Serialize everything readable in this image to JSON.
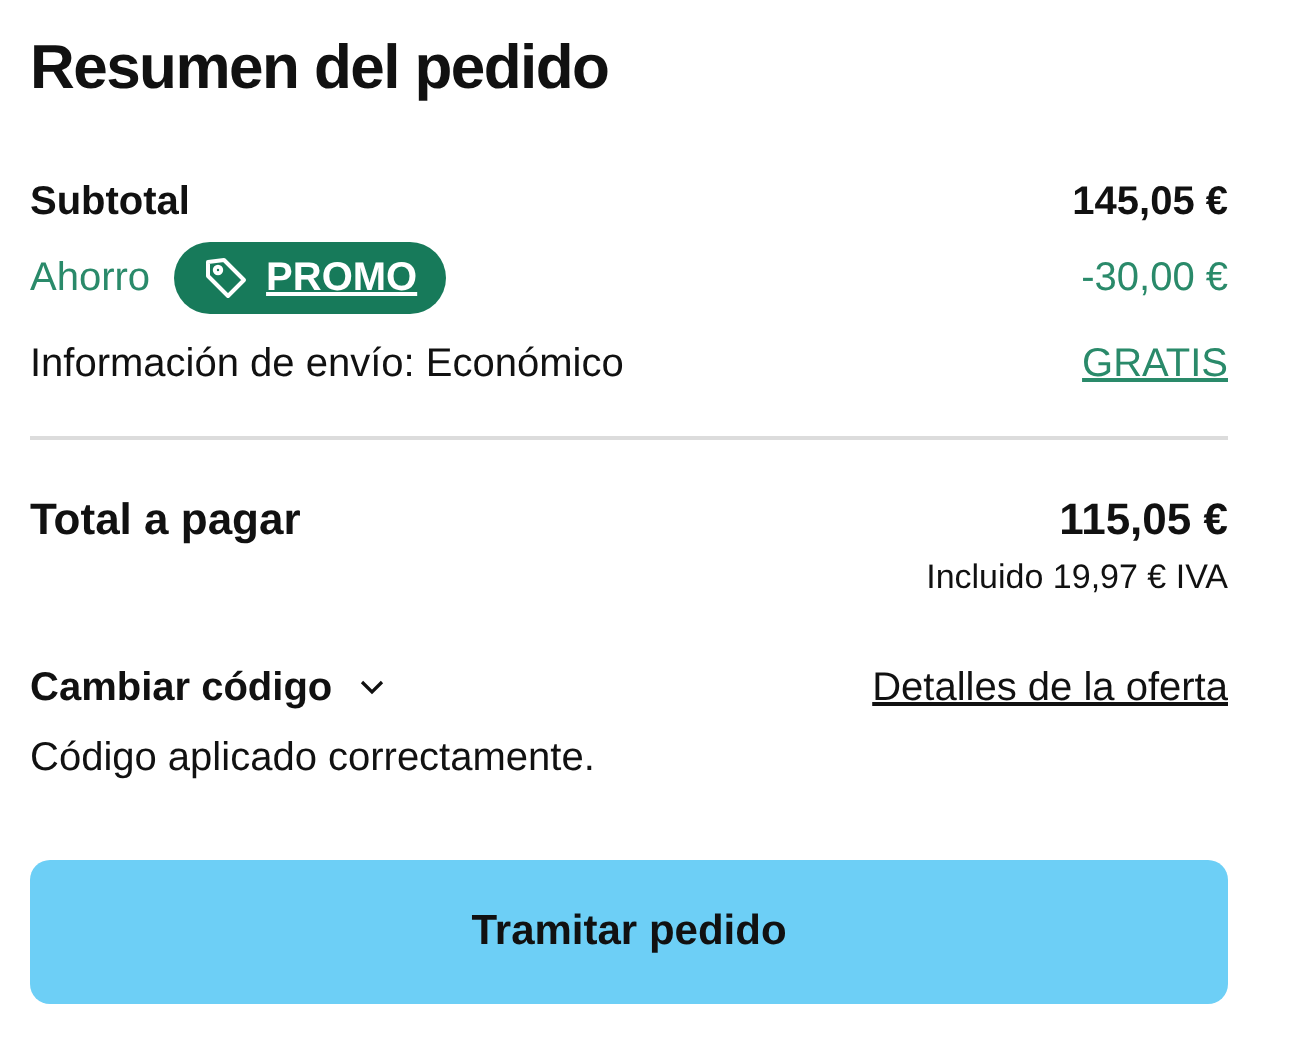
{
  "title": "Resumen del pedido",
  "subtotal": {
    "label": "Subtotal",
    "value": "145,05 €"
  },
  "savings": {
    "label": "Ahorro",
    "badge": "PROMO",
    "value": "-30,00 €"
  },
  "shipping": {
    "label": "Información de envío: Económico",
    "value": "GRATIS"
  },
  "total": {
    "label": "Total a pagar",
    "value": "115,05 €",
    "tax_note": "Incluido 19,97 € IVA"
  },
  "code": {
    "label": "Cambiar código",
    "expanded": false,
    "offer_link": "Detalles de la oferta",
    "message": "Código aplicado correctamente."
  },
  "checkout_button": "Tramitar pedido"
}
